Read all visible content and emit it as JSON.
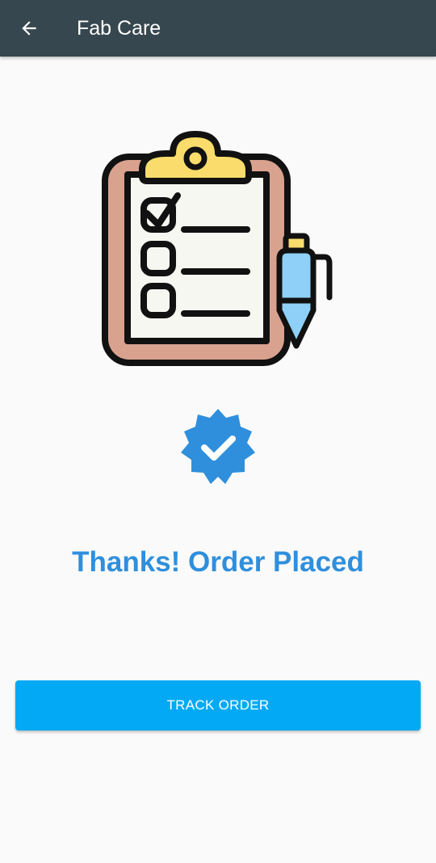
{
  "toolbar": {
    "title": "Fab Care",
    "back_icon": "arrow-left-icon",
    "background": "#37474f"
  },
  "illustration": {
    "icon": "clipboard-checklist-icon"
  },
  "status": {
    "icon": "verified-badge-icon",
    "message": "Thanks! Order Placed",
    "color": "#2f8fdc"
  },
  "actions": {
    "track_order_label": "TRACK ORDER",
    "button_color": "#03a9f4"
  }
}
